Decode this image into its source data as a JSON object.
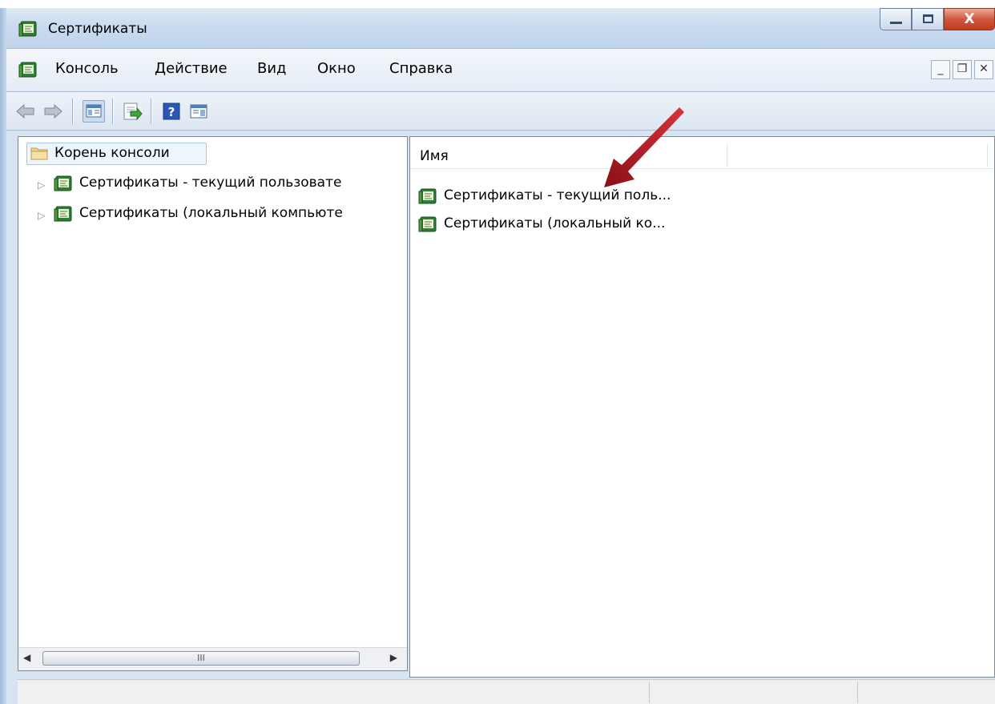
{
  "window": {
    "title": "Сертификаты"
  },
  "menu": [
    "Консоль",
    "Действие",
    "Вид",
    "Окно",
    "Справка"
  ],
  "tree": {
    "root": "Корень консоли",
    "items": [
      "Сертификаты - текущий пользовате",
      "Сертификаты (локальный компьюте"
    ]
  },
  "list": {
    "column_name": "Имя",
    "items": [
      "Сертификаты - текущий поль...",
      "Сертификаты (локальный ко..."
    ]
  },
  "scroll_thumb_glyph": "III",
  "colors": {
    "titlebar": "#c9dbef",
    "close_button": "#c13a1f",
    "annotation_arrow": "#c0202a",
    "selection_border": "#a5c9ee"
  },
  "icons": [
    "snapin-icon",
    "folder-icon",
    "back-arrow-icon",
    "forward-arrow-icon",
    "show-hide-tree-icon",
    "export-list-icon",
    "help-icon",
    "action-pane-icon"
  ]
}
